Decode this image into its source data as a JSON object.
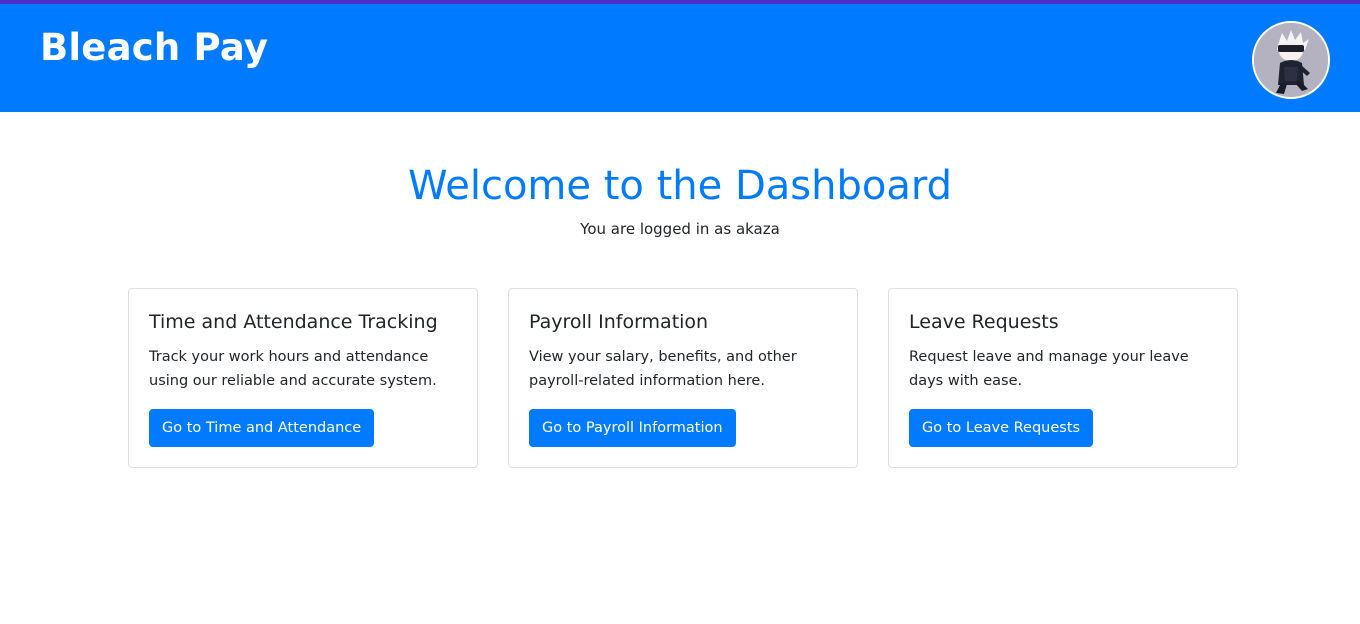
{
  "header": {
    "brand": "Bleach Pay",
    "avatar_icon": "user-avatar-icon",
    "background_color": "#007bff",
    "top_stripe_color": "#4b2ec9"
  },
  "main": {
    "title": "Welcome to the Dashboard",
    "subtitle": "You are logged in as akaza",
    "cards": [
      {
        "title": "Time and Attendance Tracking",
        "text": "Track your work hours and attendance using our reliable and accurate system.",
        "button_label": "Go to Time and Attendance"
      },
      {
        "title": "Payroll Information",
        "text": "View your salary, benefits, and other payroll-related information here.",
        "button_label": "Go to Payroll Information"
      },
      {
        "title": "Leave Requests",
        "text": "Request leave and manage your leave days with ease.",
        "button_label": "Go to Leave Requests"
      }
    ]
  },
  "colors": {
    "accent": "#007bff",
    "text": "#212529",
    "card_border": "#dfdfdf"
  }
}
